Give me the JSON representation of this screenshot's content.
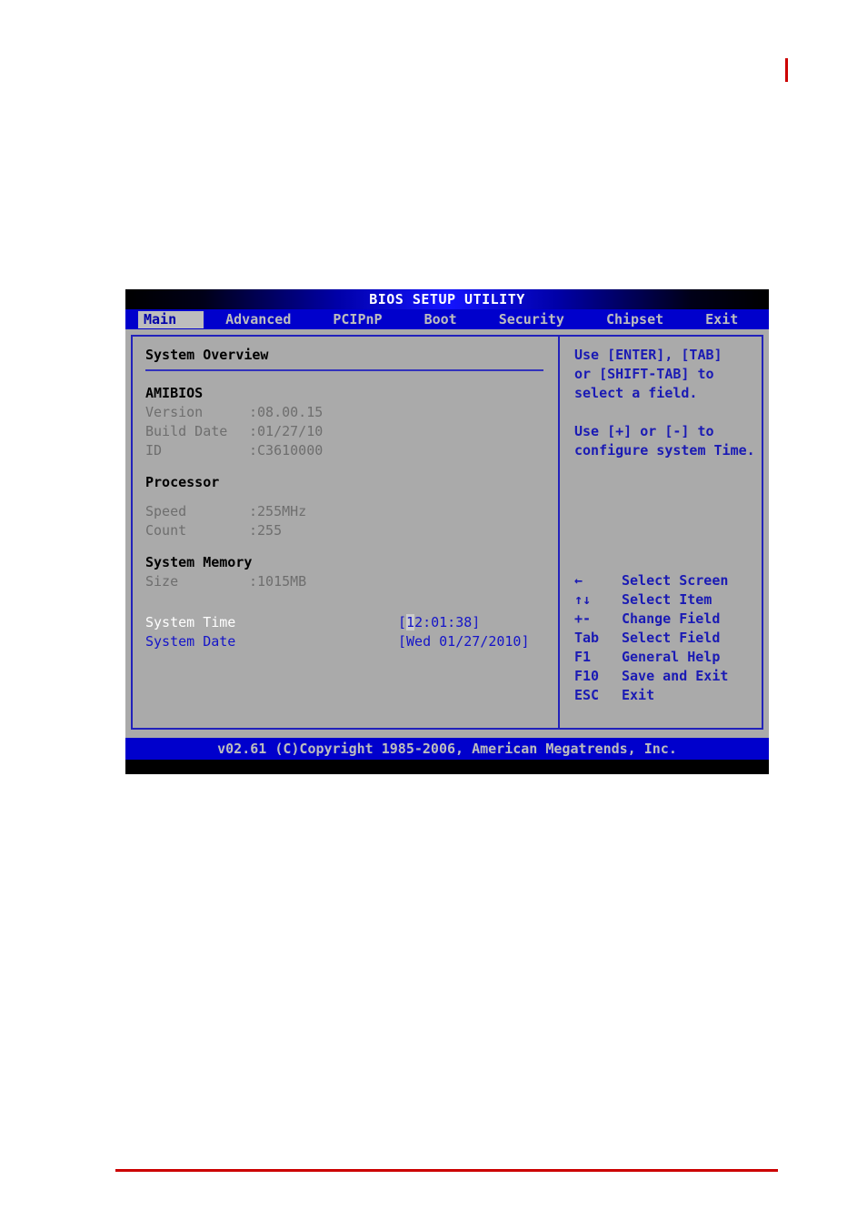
{
  "page": {
    "accent_red": "#cc0000"
  },
  "bios": {
    "title": "BIOS SETUP UTILITY",
    "tabs": [
      {
        "label": "Main",
        "active": true
      },
      {
        "label": "Advanced",
        "active": false
      },
      {
        "label": "PCIPnP",
        "active": false
      },
      {
        "label": "Boot",
        "active": false
      },
      {
        "label": "Security",
        "active": false
      },
      {
        "label": "Chipset",
        "active": false
      },
      {
        "label": "Exit",
        "active": false
      }
    ],
    "left": {
      "overview_title": "System Overview",
      "sections": [
        {
          "heading": "AMIBIOS",
          "rows": [
            {
              "key": "Version",
              "value": ":08.00.15"
            },
            {
              "key": "Build Date",
              "value": ":01/27/10"
            },
            {
              "key": "ID",
              "value": ":C3610000"
            }
          ]
        },
        {
          "heading": "Processor",
          "rows": [
            {
              "key": "Speed",
              "value": ":255MHz"
            },
            {
              "key": "Count",
              "value": ":255"
            }
          ]
        },
        {
          "heading": "System Memory",
          "rows": [
            {
              "key": "Size",
              "value": ":1015MB"
            }
          ]
        }
      ],
      "system_time": {
        "label": "System Time",
        "value_prefix": "[",
        "value_cursor": "1",
        "value_rest": "2:01:38]",
        "selected": true
      },
      "system_date": {
        "label": "System Date",
        "value": "[Wed 01/27/2010]",
        "selected": false
      }
    },
    "right": {
      "help_line_1": "Use [ENTER], [TAB]",
      "help_line_2": "or [SHIFT-TAB] to",
      "help_line_3": "select a field.",
      "help_line_4": "Use [+] or [-] to",
      "help_line_5": "configure system Time.",
      "legend": [
        {
          "key": "←",
          "action": "Select Screen"
        },
        {
          "key": "↑↓",
          "action": "Select Item"
        },
        {
          "key": "+-",
          "action": "Change Field"
        },
        {
          "key": "Tab",
          "action": "Select Field"
        },
        {
          "key": "F1",
          "action": "General Help"
        },
        {
          "key": "F10",
          "action": "Save and Exit"
        },
        {
          "key": "ESC",
          "action": "Exit"
        }
      ]
    },
    "footer": "v02.61 (C)Copyright 1985-2006, American Megatrends, Inc."
  }
}
